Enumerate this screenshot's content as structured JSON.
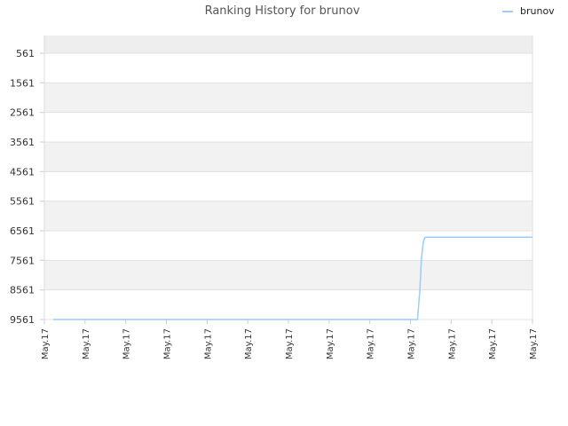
{
  "chart_data": {
    "type": "line",
    "title": "Ranking History for brunov",
    "xlabel": "",
    "ylabel": "",
    "y_inverted": true,
    "ylim": [
      9561,
      -39
    ],
    "yticks": [
      561,
      1561,
      2561,
      3561,
      4561,
      5561,
      6561,
      7561,
      8561,
      9561
    ],
    "x_tick_labels": [
      "May.17",
      "May.17",
      "May.17",
      "May.17",
      "May.17",
      "May.17",
      "May.17",
      "May.17",
      "May.17",
      "May.17",
      "May.17",
      "May.17",
      "May.17"
    ],
    "grid": true,
    "legend_position": "top-right",
    "colors": {
      "series": "#99ccff",
      "band": "#f2f2f2",
      "grid": "#e0e0e0"
    },
    "series": [
      {
        "name": "brunov",
        "x": [
          0.0,
          0.76,
          0.765,
          0.768,
          0.772,
          0.775,
          0.778,
          0.782,
          1.0
        ],
        "values": [
          9561,
          9561,
          8561,
          7561,
          6961,
          6800,
          6780,
          6780,
          6780
        ]
      }
    ]
  }
}
